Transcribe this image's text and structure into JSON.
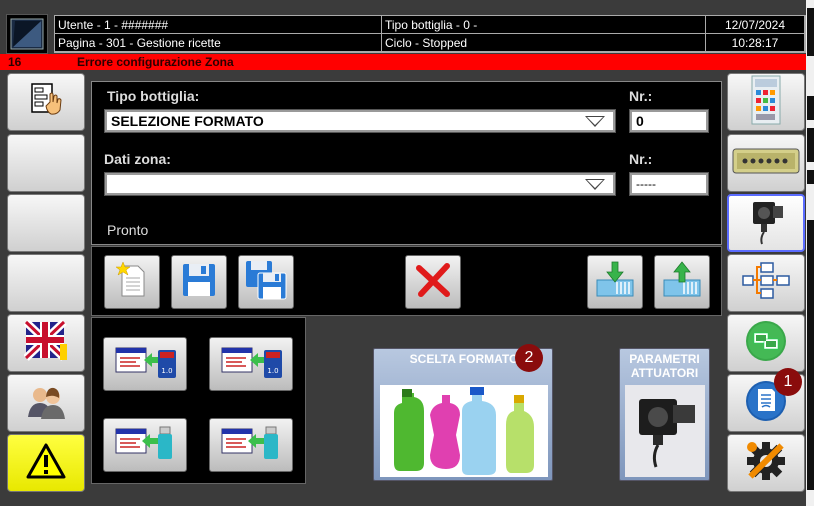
{
  "header": {
    "user": "Utente - 1 - #######",
    "page": "Pagina - 301 - Gestione ricette",
    "bottle_type": "Tipo bottiglia - 0 -",
    "cycle": "Ciclo - Stopped",
    "date": "12/07/2024",
    "time": "10:28:17"
  },
  "alarm": {
    "code": "16",
    "message": "Errore configurazione Zona"
  },
  "form": {
    "bottle_label": "Tipo bottiglia:",
    "bottle_value": "SELEZIONE FORMATO",
    "nr_label_1": "Nr.:",
    "nr_value_1": "0",
    "zone_label": "Dati zona:",
    "zone_value": "",
    "nr_label_2": "Nr.:",
    "nr_value_2": "-----",
    "status": "Pronto"
  },
  "big_buttons": {
    "format_title": "SCELTA FORMATO",
    "actuators_title": "PARAMETRI ATTUATORI"
  },
  "badges": {
    "format_badge": "2",
    "right_badge": "1"
  },
  "colors": {
    "alarm_red": "#ff0000",
    "badge_red": "#8a0c0c",
    "warning_yellow": "#ffff00",
    "selected_border": "#5b6cff"
  },
  "icons": {
    "left": [
      "recipe-hand-icon",
      "empty",
      "empty",
      "empty",
      "uk-flag-icon",
      "users-icon",
      "warning-icon"
    ],
    "right": [
      "control-panel-icon",
      "pcb-board-icon",
      "actuator-icon",
      "network-tree-icon",
      "monitor-network-icon",
      "document-icon",
      "settings-wrench-icon"
    ],
    "toolbar": [
      "new-file-icon",
      "save-icon",
      "save-as-icon",
      "delete-icon",
      "import-icon",
      "export-icon"
    ],
    "transfer": [
      "sd-import-icon",
      "sd-export-icon",
      "usb-import-icon",
      "usb-export-icon"
    ]
  }
}
